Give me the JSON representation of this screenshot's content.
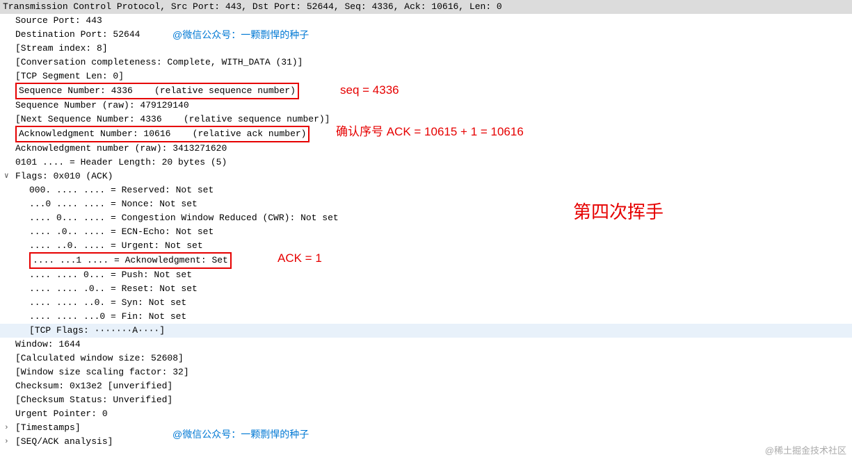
{
  "header": "Transmission Control Protocol, Src Port: 443, Dst Port: 52644, Seq: 4336, Ack: 10616, Len: 0",
  "lines": {
    "srcPort": "Source Port: 443",
    "dstPort": "Destination Port: 52644",
    "streamIdx": "[Stream index: 8]",
    "convComp": "[Conversation completeness: Complete, WITH_DATA (31)]",
    "tcpSegLen": "[TCP Segment Len: 0]",
    "seqNum": "Sequence Number: 4336    (relative sequence number)",
    "seqNumRaw": "Sequence Number (raw): 479129140",
    "nextSeq": "[Next Sequence Number: 4336    (relative sequence number)]",
    "ackNum": "Acknowledgment Number: 10616    (relative ack number)",
    "ackNumRaw": "Acknowledgment number (raw): 3413271620",
    "headerLen": "0101 .... = Header Length: 20 bytes (5)",
    "flagsHeader": "Flags: 0x010 (ACK)",
    "flagReserved": "000. .... .... = Reserved: Not set",
    "flagNonce": "...0 .... .... = Nonce: Not set",
    "flagCwr": ".... 0... .... = Congestion Window Reduced (CWR): Not set",
    "flagEcn": ".... .0.. .... = ECN-Echo: Not set",
    "flagUrg": ".... ..0. .... = Urgent: Not set",
    "flagAck": ".... ...1 .... = Acknowledgment: Set",
    "flagPsh": ".... .... 0... = Push: Not set",
    "flagRst": ".... .... .0.. = Reset: Not set",
    "flagSyn": ".... .... ..0. = Syn: Not set",
    "flagFin": ".... .... ...0 = Fin: Not set",
    "tcpFlagsStr": "[TCP Flags: ·······A····]",
    "window": "Window: 1644",
    "calcWin": "[Calculated window size: 52608]",
    "winScale": "[Window size scaling factor: 32]",
    "checksum": "Checksum: 0x13e2 [unverified]",
    "checksumStatus": "[Checksum Status: Unverified]",
    "urgPtr": "Urgent Pointer: 0",
    "timestamps": "[Timestamps]",
    "seqAck": "[SEQ/ACK analysis]"
  },
  "annotations": {
    "watermark1": "@微信公众号：一颗剽悍的种子",
    "watermark2": "@微信公众号：一颗剽悍的种子",
    "seqAnnot": "seq = 4336",
    "ackAnnot": "确认序号 ACK = 10615 + 1 = 10616",
    "ackFlagAnnot": "ACK = 1",
    "titleAnnot": "第四次挥手",
    "footer": "@稀土掘金技术社区"
  },
  "expanders": {
    "down": "∨",
    "right": "›"
  }
}
